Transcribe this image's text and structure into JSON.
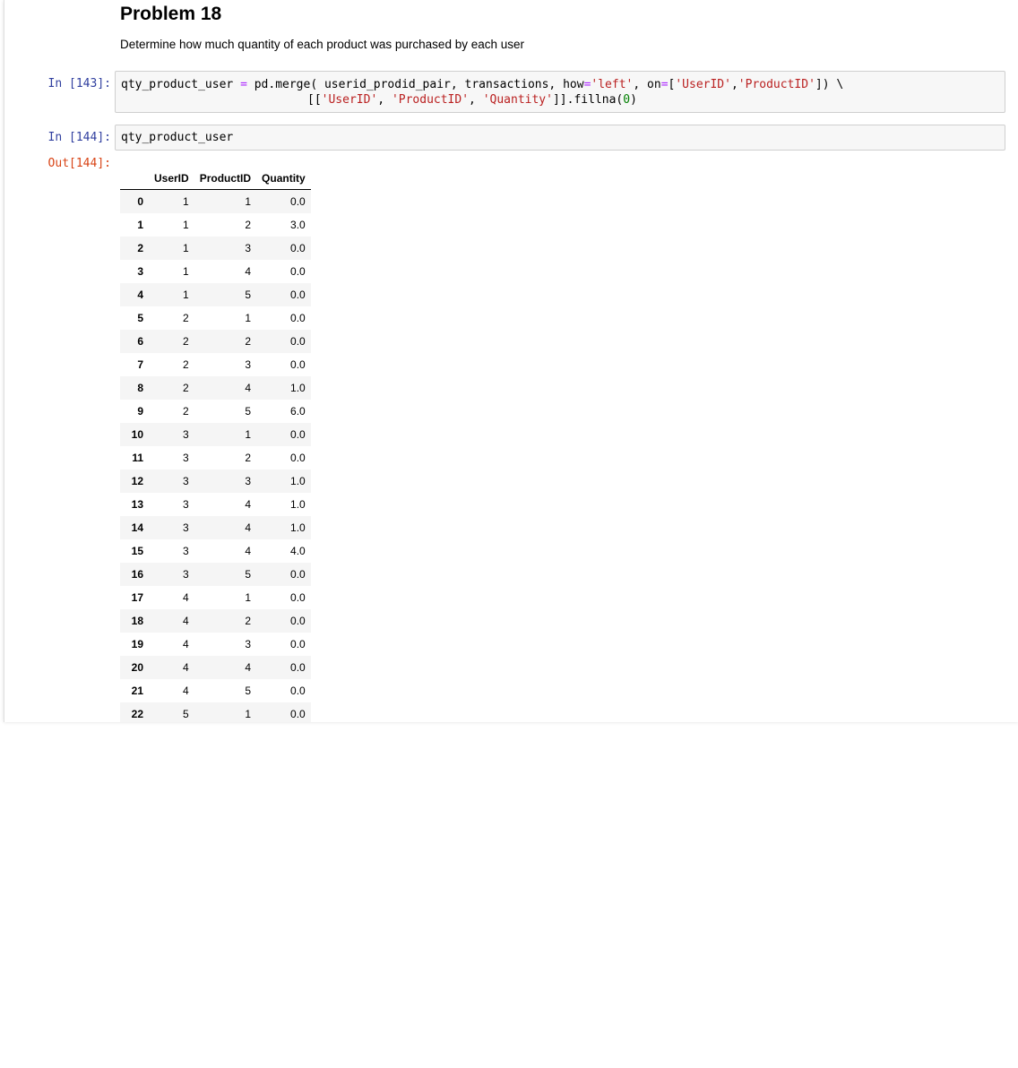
{
  "markdown": {
    "title": "Problem 18",
    "description": "Determine how much quantity of each product was purchased by each user"
  },
  "cells": {
    "cell1": {
      "prompt": "In [143]:",
      "line1": {
        "a": "qty_product_user ",
        "b": "=",
        "c": " pd.merge( userid_prodid_pair, transactions, how",
        "d": "=",
        "e": "'left'",
        "f": ", on",
        "g": "=",
        "h": "[",
        "i": "'UserID'",
        "j": ",",
        "k": "'ProductID'",
        "l": "]) \\"
      },
      "line2": {
        "a": "[[",
        "b": "'UserID'",
        "c": ", ",
        "d": "'ProductID'",
        "e": ", ",
        "f": "'Quantity'",
        "g": "]].fillna(",
        "h": "0",
        "i": ")"
      }
    },
    "cell2": {
      "prompt": "In [144]:",
      "code": "qty_product_user",
      "out_prompt": "Out[144]:"
    }
  },
  "table": {
    "columns": [
      "UserID",
      "ProductID",
      "Quantity"
    ],
    "rows": [
      {
        "index": "0",
        "UserID": "1",
        "ProductID": "1",
        "Quantity": "0.0"
      },
      {
        "index": "1",
        "UserID": "1",
        "ProductID": "2",
        "Quantity": "3.0"
      },
      {
        "index": "2",
        "UserID": "1",
        "ProductID": "3",
        "Quantity": "0.0"
      },
      {
        "index": "3",
        "UserID": "1",
        "ProductID": "4",
        "Quantity": "0.0"
      },
      {
        "index": "4",
        "UserID": "1",
        "ProductID": "5",
        "Quantity": "0.0"
      },
      {
        "index": "5",
        "UserID": "2",
        "ProductID": "1",
        "Quantity": "0.0"
      },
      {
        "index": "6",
        "UserID": "2",
        "ProductID": "2",
        "Quantity": "0.0"
      },
      {
        "index": "7",
        "UserID": "2",
        "ProductID": "3",
        "Quantity": "0.0"
      },
      {
        "index": "8",
        "UserID": "2",
        "ProductID": "4",
        "Quantity": "1.0"
      },
      {
        "index": "9",
        "UserID": "2",
        "ProductID": "5",
        "Quantity": "6.0"
      },
      {
        "index": "10",
        "UserID": "3",
        "ProductID": "1",
        "Quantity": "0.0"
      },
      {
        "index": "11",
        "UserID": "3",
        "ProductID": "2",
        "Quantity": "0.0"
      },
      {
        "index": "12",
        "UserID": "3",
        "ProductID": "3",
        "Quantity": "1.0"
      },
      {
        "index": "13",
        "UserID": "3",
        "ProductID": "4",
        "Quantity": "1.0"
      },
      {
        "index": "14",
        "UserID": "3",
        "ProductID": "4",
        "Quantity": "1.0"
      },
      {
        "index": "15",
        "UserID": "3",
        "ProductID": "4",
        "Quantity": "4.0"
      },
      {
        "index": "16",
        "UserID": "3",
        "ProductID": "5",
        "Quantity": "0.0"
      },
      {
        "index": "17",
        "UserID": "4",
        "ProductID": "1",
        "Quantity": "0.0"
      },
      {
        "index": "18",
        "UserID": "4",
        "ProductID": "2",
        "Quantity": "0.0"
      },
      {
        "index": "19",
        "UserID": "4",
        "ProductID": "3",
        "Quantity": "0.0"
      },
      {
        "index": "20",
        "UserID": "4",
        "ProductID": "4",
        "Quantity": "0.0"
      },
      {
        "index": "21",
        "UserID": "4",
        "ProductID": "5",
        "Quantity": "0.0"
      },
      {
        "index": "22",
        "UserID": "5",
        "ProductID": "1",
        "Quantity": "0.0"
      }
    ]
  },
  "colors": {
    "in_prompt": "#303f9f",
    "out_prompt": "#d84315",
    "code_bg": "#f7f7f7",
    "code_border": "#cfcfcf",
    "string": "#ba2121",
    "operator": "#aa22ff",
    "number": "#008000",
    "row_stripe": "#f5f5f5"
  }
}
